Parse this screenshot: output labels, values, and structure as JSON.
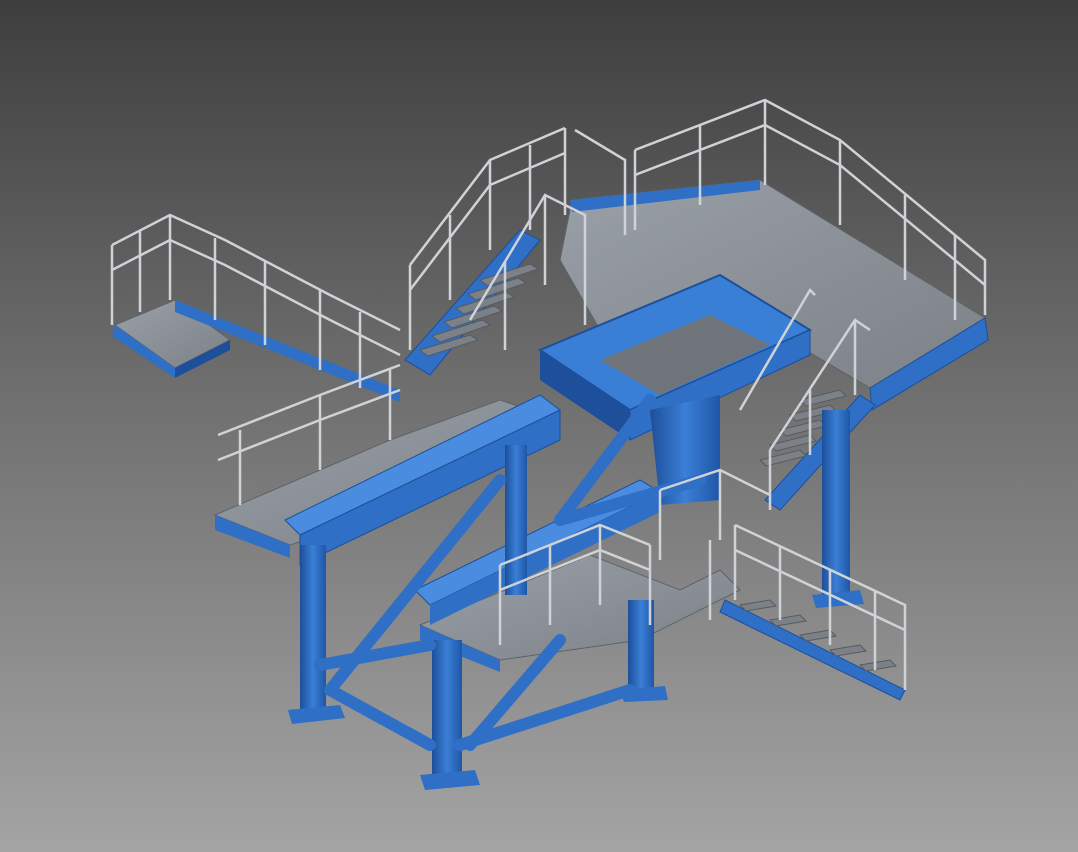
{
  "viewport": {
    "background_top": "#3e3e3e",
    "background_bottom": "#a4a4a4"
  },
  "model": {
    "steel_color": "#2f6fc6",
    "steel_dark": "#1d4f9a",
    "steel_light": "#4a8de0",
    "deck_color": "#8a8f96",
    "deck_edge": "#6c7077",
    "rail_color": "#cfd3d8"
  }
}
